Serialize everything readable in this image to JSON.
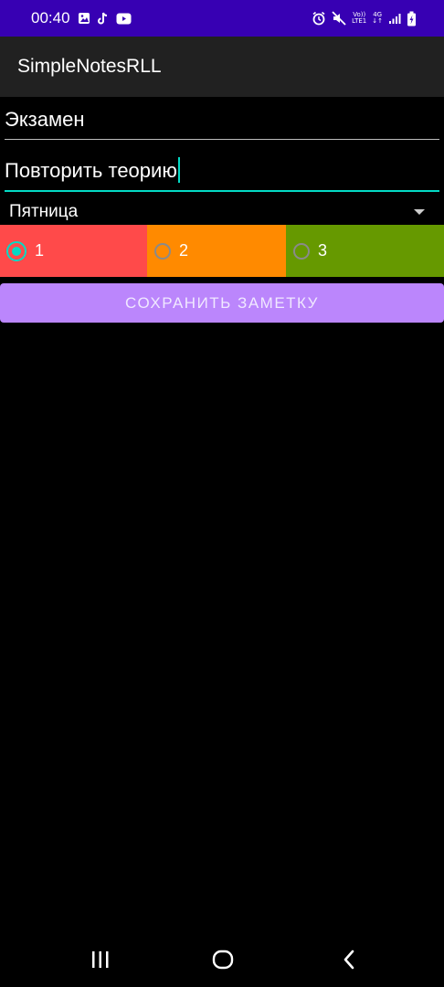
{
  "status_bar": {
    "time": "00:40",
    "left_icons": [
      "image-icon",
      "tiktok-icon",
      "youtube-icon"
    ],
    "right_icons": [
      "alarm-icon",
      "mute-icon",
      "volte-icon",
      "4g-icon",
      "signal-icon",
      "battery-icon"
    ],
    "volte_top": "Vo))",
    "volte_bottom": "LTE1",
    "net_type": "4G",
    "background": "#3700b3"
  },
  "app_bar": {
    "title": "SimpleNotesRLL",
    "background": "#212121"
  },
  "form": {
    "title_value": "Экзамен",
    "body_value": "Повторить теорию",
    "day_selected": "Пятница",
    "accent_color": "#03dac5",
    "priorities": [
      {
        "label": "1",
        "color": "#ff4a4a",
        "checked": true
      },
      {
        "label": "2",
        "color": "#ff8a00",
        "checked": false
      },
      {
        "label": "3",
        "color": "#669900",
        "checked": false
      }
    ],
    "save_label": "СОХРАНИТЬ ЗАМЕТКУ",
    "save_color": "#bb86fc"
  },
  "nav_bar": {
    "buttons": [
      "recent-apps-icon",
      "home-icon",
      "back-icon"
    ]
  }
}
